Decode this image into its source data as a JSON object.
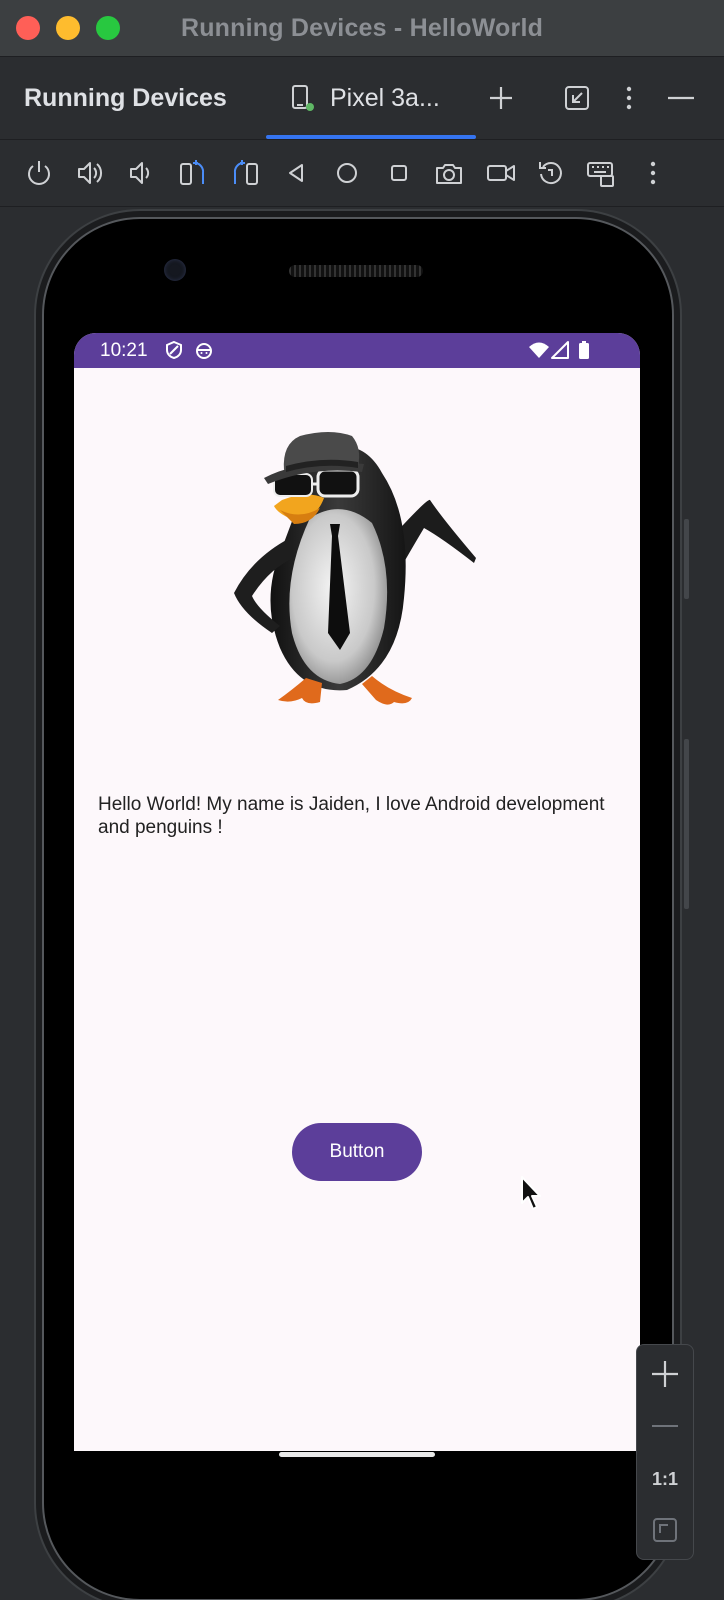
{
  "window": {
    "title": "Running Devices - HelloWorld"
  },
  "tool_window": {
    "title": "Running Devices",
    "device_tab_label": "Pixel 3a...",
    "header_icons": [
      "device-icon",
      "add-icon",
      "restore-icon",
      "more-vert-icon",
      "minimize-icon"
    ]
  },
  "toolbar": {
    "icons": [
      "power-icon",
      "volume-up-icon",
      "volume-down-icon",
      "rotate-left-icon",
      "rotate-right-icon",
      "back-icon",
      "home-icon",
      "overview-icon",
      "screenshot-icon",
      "screen-record-icon",
      "reset-icon",
      "keyboard-icon",
      "more-vert-icon"
    ]
  },
  "phone": {
    "status_bar": {
      "time": "10:21",
      "left_icons": [
        "shield-icon",
        "android-icon"
      ],
      "right_icons": [
        "wifi-icon",
        "signal-icon",
        "battery-icon"
      ]
    },
    "app": {
      "hello_text": "Hello World! My name is Jaiden, I love Android development and penguins !",
      "button_label": "Button",
      "image": "penguin-image"
    }
  },
  "zoom_controls": {
    "actual_size_label": "1:1",
    "icons": [
      "zoom-in-icon",
      "zoom-out-icon",
      "fit-screen-icon"
    ]
  },
  "colors": {
    "accent": "#3574f0",
    "status_bar": "#5c3e9a",
    "button": "#5c3e9a",
    "screen_background": "#fdf8fb"
  }
}
